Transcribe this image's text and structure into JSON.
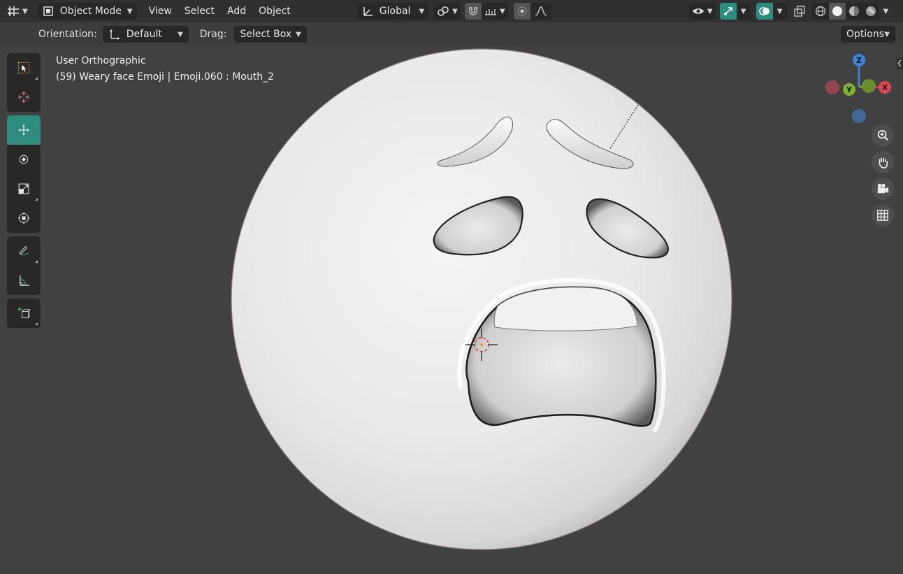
{
  "header": {
    "editor_type_icon": "grid-axes-icon",
    "mode": "Object Mode",
    "menus": [
      "View",
      "Select",
      "Add",
      "Object"
    ],
    "transform_orientation": "Global"
  },
  "tool_settings": {
    "orientation_label": "Orientation:",
    "orientation_value": "Default",
    "drag_label": "Drag:",
    "drag_value": "Select Box",
    "options_label": "Options"
  },
  "viewport": {
    "view_name": "User Orthographic",
    "object_info": "(59) Weary face Emoji | Emoji.060 : Mouth_2",
    "model": "weary-face-emoji"
  },
  "gizmo": {
    "z": "Z",
    "y": "Y",
    "x": "X"
  },
  "colors": {
    "active_tool": "#2f8b7e",
    "x_axis": "#e04453",
    "y_axis": "#7fb02f",
    "z_axis": "#3d85d8"
  }
}
